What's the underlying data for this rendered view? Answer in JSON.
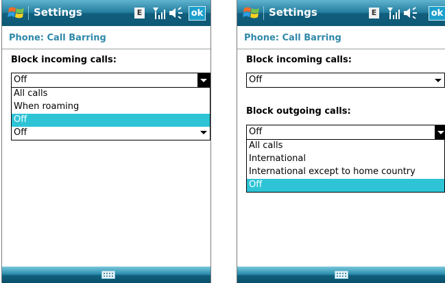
{
  "colors": {
    "title_gradient_top": "#5fb3cf",
    "title_gradient_bottom": "#0d5874",
    "subhead": "#2f88a9",
    "selection": "#2ec4d6"
  },
  "left": {
    "title": "Settings",
    "edge_label": "E",
    "ok_label": "ok",
    "subheading": "Phone: Call Barring",
    "incoming_label": "Block incoming calls:",
    "incoming_value": "Off",
    "incoming_options": [
      "All calls",
      "When roaming",
      "Off"
    ],
    "incoming_selected_index": 2,
    "outgoing_value": "Off"
  },
  "right": {
    "title": "Settings",
    "edge_label": "E",
    "ok_label": "ok",
    "subheading": "Phone: Call Barring",
    "incoming_label": "Block incoming calls:",
    "incoming_value": "Off",
    "outgoing_label": "Block outgoing calls:",
    "outgoing_value": "Off",
    "outgoing_options": [
      "All calls",
      "International",
      "International except to home country",
      "Off"
    ],
    "outgoing_selected_index": 3
  },
  "icons": [
    "windows-start-icon",
    "edge-icon",
    "signal-icon",
    "speaker-icon",
    "keyboard-icon"
  ]
}
